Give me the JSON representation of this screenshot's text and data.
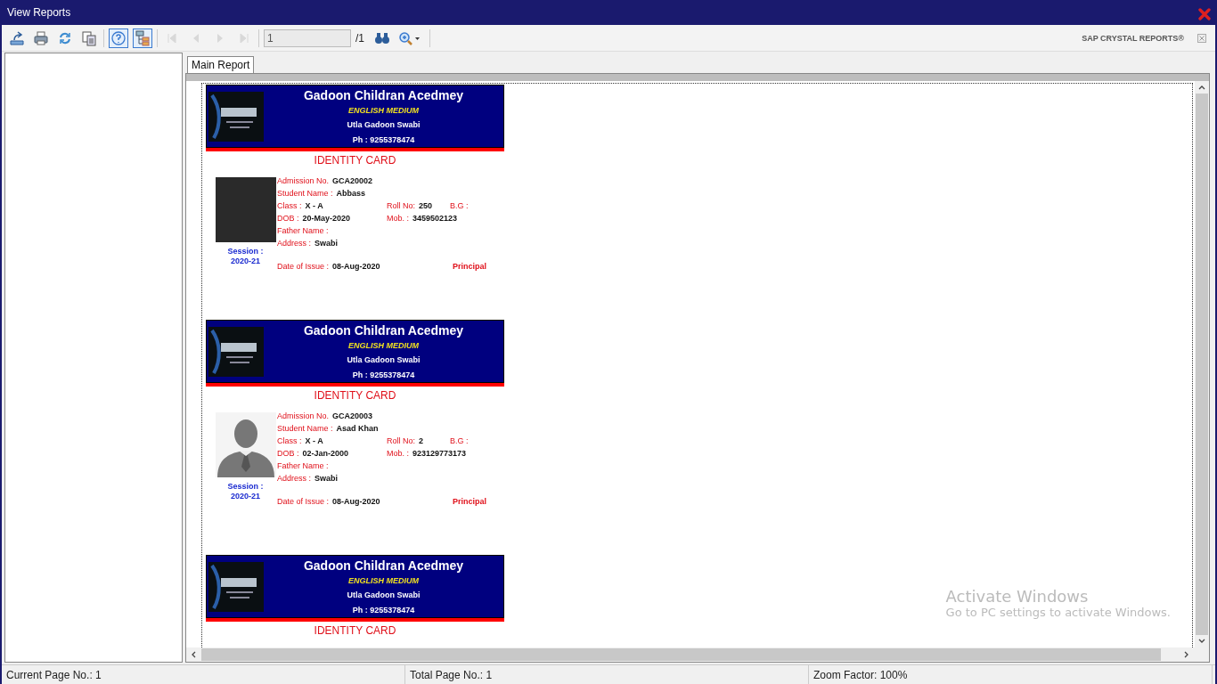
{
  "window": {
    "title": "View Reports"
  },
  "toolbar": {
    "tools": [
      {
        "kind": "export",
        "on": false,
        "disabled": false
      },
      {
        "kind": "print",
        "on": false,
        "disabled": false
      },
      {
        "kind": "refresh",
        "on": false,
        "disabled": false
      },
      {
        "kind": "copy",
        "on": false,
        "disabled": false
      },
      {
        "kind": "sep"
      },
      {
        "kind": "help",
        "on": true,
        "disabled": false
      },
      {
        "kind": "tree",
        "on": true,
        "disabled": false
      },
      {
        "kind": "sep"
      },
      {
        "kind": "first",
        "on": false,
        "disabled": true
      },
      {
        "kind": "prev",
        "on": false,
        "disabled": true
      },
      {
        "kind": "next",
        "on": false,
        "disabled": true
      },
      {
        "kind": "last",
        "on": false,
        "disabled": true
      },
      {
        "kind": "sep"
      }
    ],
    "page_input": {
      "value": "1"
    },
    "page_total": "/1",
    "brand": "SAP CRYSTAL REPORTS®"
  },
  "tabs": [
    {
      "label": "Main Report",
      "selected": true
    }
  ],
  "cards": [
    {
      "school": "Gadoon Childran Acedmey",
      "medium": "ENGLISH MEDIUM",
      "address": "Utla Gadoon  Swabi",
      "phone": "Ph : 9255378474",
      "heading": "IDENTITY CARD",
      "kind": "photo",
      "session_label": "Session :",
      "session": "2020-21",
      "rows": [
        [
          {
            "label": "Admission No.",
            "value": "GCA20002"
          }
        ],
        [
          {
            "label": "Student Name :",
            "value": "Abbass"
          }
        ],
        [
          {
            "label": "Class :",
            "value": "X - A"
          },
          {
            "label": "Roll No:",
            "value": "250"
          },
          {
            "label": "B.G :"
          }
        ],
        [
          {
            "label": "DOB :",
            "value": "20-May-2020"
          },
          {
            "label": "Mob. :",
            "value": "3459502123"
          }
        ],
        [
          {
            "label": "Father Name :"
          }
        ],
        [
          {
            "label": "Address :",
            "value": "Swabi"
          }
        ]
      ],
      "issue_label": "Date of Issue :",
      "issue": "08-Aug-2020",
      "signature": "Principal"
    },
    {
      "school": "Gadoon Childran Acedmey",
      "medium": "ENGLISH MEDIUM",
      "address": "Utla Gadoon  Swabi",
      "phone": "Ph : 9255378474",
      "heading": "IDENTITY CARD",
      "kind": "silhouette",
      "session_label": "Session :",
      "session": "2020-21",
      "rows": [
        [
          {
            "label": "Admission No.",
            "value": "GCA20003"
          }
        ],
        [
          {
            "label": "Student Name :",
            "value": "Asad Khan"
          }
        ],
        [
          {
            "label": "Class :",
            "value": "X - A"
          },
          {
            "label": "Roll No:",
            "value": "2"
          },
          {
            "label": "B.G :"
          }
        ],
        [
          {
            "label": "DOB :",
            "value": "02-Jan-2000"
          },
          {
            "label": "Mob. :",
            "value": "923129773173"
          }
        ],
        [
          {
            "label": "Father Name :"
          }
        ],
        [
          {
            "label": "Address :",
            "value": "Swabi"
          }
        ]
      ],
      "issue_label": "Date of Issue :",
      "issue": "08-Aug-2020",
      "signature": "Principal"
    },
    {
      "school": "Gadoon Childran Acedmey",
      "medium": "ENGLISH MEDIUM",
      "address": "Utla Gadoon  Swabi",
      "phone": "Ph : 9255378474",
      "heading": "IDENTITY CARD",
      "kind": "cut"
    }
  ],
  "watermark": {
    "title": "Activate Windows",
    "text": "Go to PC settings to activate Windows."
  },
  "status_bar": [
    "Current Page No.: 1",
    "Total Page No.: 1",
    "Zoom Factor: 100%"
  ]
}
